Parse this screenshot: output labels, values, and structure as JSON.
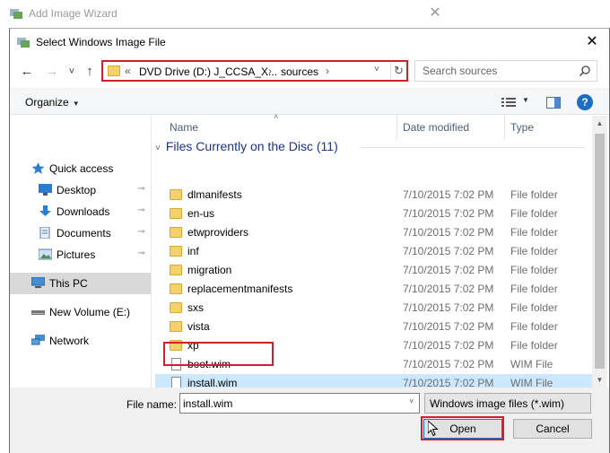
{
  "background_window": {
    "title": "Add Image Wizard",
    "close_glyph": "✕"
  },
  "dialog": {
    "title": "Select Windows Image File",
    "close_glyph": "✕"
  },
  "nav": {
    "back": "←",
    "forward": "→",
    "recent": "˅",
    "up": "↑"
  },
  "address": {
    "overflow": "«",
    "crumbs": [
      "DVD Drive (D:) J_CCSA_X...",
      "sources"
    ],
    "separator": "›",
    "dropdown": "˅",
    "refresh": "↻"
  },
  "search": {
    "placeholder": "Search sources"
  },
  "toolbar": {
    "organize_label": "Organize",
    "caret": "▼",
    "help": "?"
  },
  "sidebar": {
    "items": [
      {
        "label": "Quick access",
        "icon": "star-icon",
        "pinned": false
      },
      {
        "label": "Desktop",
        "icon": "desktop-icon",
        "pinned": true
      },
      {
        "label": "Downloads",
        "icon": "download-icon",
        "pinned": true
      },
      {
        "label": "Documents",
        "icon": "documents-icon",
        "pinned": true
      },
      {
        "label": "Pictures",
        "icon": "pictures-icon",
        "pinned": true
      },
      {
        "label": "This PC",
        "icon": "computer-icon",
        "pinned": false,
        "selected": true
      },
      {
        "label": "New Volume (E:)",
        "icon": "drive-icon",
        "pinned": false
      },
      {
        "label": "Network",
        "icon": "network-icon",
        "pinned": false
      }
    ],
    "pin_glyph": "📌"
  },
  "columns": {
    "name": "Name",
    "date": "Date modified",
    "type": "Type",
    "sort_glyph": "˄"
  },
  "group": {
    "caret": "˅",
    "label": "Files Currently on the Disc (11)"
  },
  "files": [
    {
      "name": "dlmanifests",
      "date": "7/10/2015 7:02 PM",
      "type": "File folder",
      "kind": "folder"
    },
    {
      "name": "en-us",
      "date": "7/10/2015 7:02 PM",
      "type": "File folder",
      "kind": "folder"
    },
    {
      "name": "etwproviders",
      "date": "7/10/2015 7:02 PM",
      "type": "File folder",
      "kind": "folder"
    },
    {
      "name": "inf",
      "date": "7/10/2015 7:02 PM",
      "type": "File folder",
      "kind": "folder"
    },
    {
      "name": "migration",
      "date": "7/10/2015 7:02 PM",
      "type": "File folder",
      "kind": "folder"
    },
    {
      "name": "replacementmanifests",
      "date": "7/10/2015 7:02 PM",
      "type": "File folder",
      "kind": "folder"
    },
    {
      "name": "sxs",
      "date": "7/10/2015 7:02 PM",
      "type": "File folder",
      "kind": "folder"
    },
    {
      "name": "vista",
      "date": "7/10/2015 7:02 PM",
      "type": "File folder",
      "kind": "folder"
    },
    {
      "name": "xp",
      "date": "7/10/2015 7:02 PM",
      "type": "File folder",
      "kind": "folder"
    },
    {
      "name": "boot.wim",
      "date": "7/10/2015 7:02 PM",
      "type": "WIM File",
      "kind": "file"
    },
    {
      "name": "install.wim",
      "date": "7/10/2015 7:02 PM",
      "type": "WIM File",
      "kind": "file",
      "selected": true
    }
  ],
  "scrollbar": {
    "up": "▲",
    "down": "▼"
  },
  "footer": {
    "filename_label": "File name:",
    "filename_value": "install.wim",
    "filename_dropdown": "˅",
    "filetype_value": "Windows image files (*.wim)",
    "filetype_dropdown": "˅",
    "open_label": "Open",
    "cancel_label": "Cancel"
  },
  "colors": {
    "highlight_red": "#d1202a",
    "selection": "#cce8ff",
    "group_header": "#1e3287"
  }
}
